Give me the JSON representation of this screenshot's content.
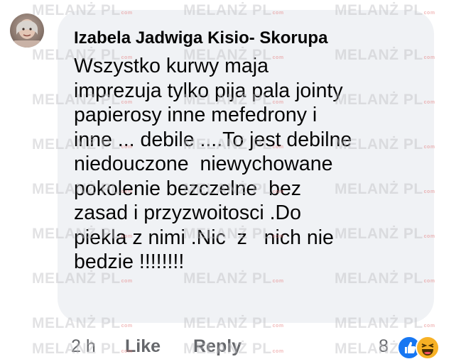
{
  "comment": {
    "author": "Izabela Jadwiga Kisio- Skorupa",
    "lines": [
      "Wszystko kurwy maja",
      "imprezuja tylko pija pala jointy",
      "papierosy inne mefedrony i",
      "inne ... debile ....To jest debilne",
      "niedouczone  niewychowane",
      "pokolenie bezczelne  bez",
      "zasad i przyzwoitosci .Do",
      "piekla z nimi .Nic  z   nich nie",
      "bedzie !!!!!!!!"
    ]
  },
  "actions": {
    "time": "2 h",
    "like": "Like",
    "reply": "Reply",
    "reaction_count": "8",
    "reactions": [
      "like-icon",
      "haha-icon"
    ]
  },
  "watermark": {
    "text": "MELANŻ PL",
    "suffix": "com"
  },
  "colors": {
    "bubble": "#f0f2f5",
    "text": "#050505",
    "meta": "#65676b",
    "like_blue": "#1877f2",
    "haha_yellow": "#f7b125"
  }
}
